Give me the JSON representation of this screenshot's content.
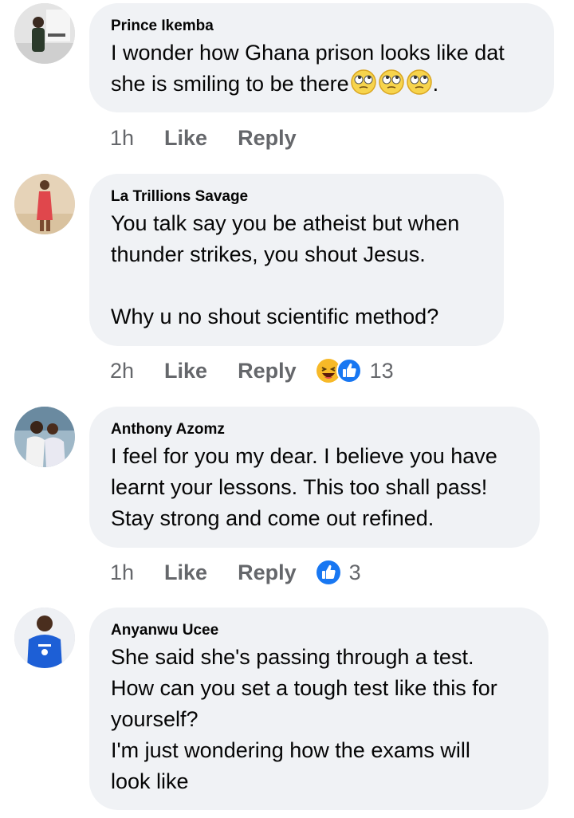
{
  "comments": [
    {
      "author": "Prince Ikemba",
      "text_lines": [
        "I wonder how Ghana prison looks like dat",
        "she is smiling to be there"
      ],
      "trailing_emoji": [
        "rolling-eyes-emoji",
        "rolling-eyes-emoji",
        "rolling-eyes-emoji"
      ],
      "trailing_text": ".",
      "time": "1h",
      "like_label": "Like",
      "reply_label": "Reply",
      "reaction_count": ""
    },
    {
      "author": "La Trillions Savage",
      "text_lines": [
        "You talk say you be atheist but when",
        "thunder strikes, you shout Jesus.",
        "",
        "Why u no shout scientific method?"
      ],
      "time": "2h",
      "like_label": "Like",
      "reply_label": "Reply",
      "reactions": [
        "haha-icon",
        "like-icon"
      ],
      "reaction_count": "13"
    },
    {
      "author": "Anthony Azomz",
      "text_lines": [
        "I feel for you my dear. I believe you have",
        "learnt your lessons. This too shall pass!",
        "Stay strong and come out refined."
      ],
      "time": "1h",
      "like_label": "Like",
      "reply_label": "Reply",
      "reactions": [
        "like-icon"
      ],
      "reaction_count": "3"
    },
    {
      "author": "Anyanwu Ucee",
      "text_lines": [
        "She said she's passing through a test.",
        "How can you set a tough test like this for",
        "yourself?",
        "I'm just wondering how the exams will",
        "look like"
      ]
    }
  ],
  "colors": {
    "bubble": "#f0f2f5",
    "text": "#050505",
    "secondary": "#65676b",
    "like_blue": "#1877f2",
    "haha_yellow": "#f7b928"
  }
}
